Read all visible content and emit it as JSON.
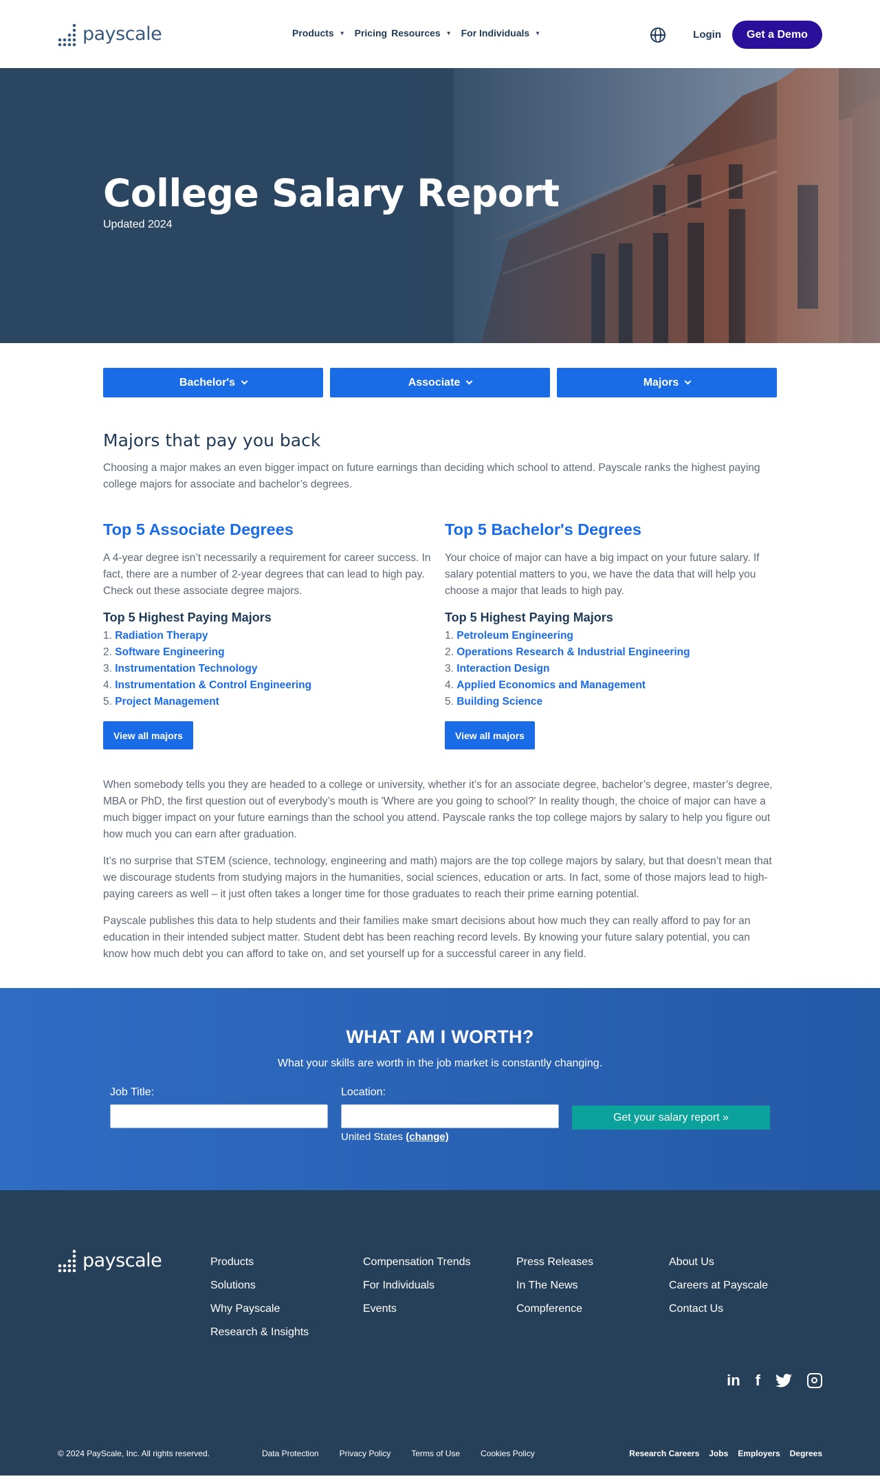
{
  "header": {
    "logo_text": "payscale",
    "nav": [
      "Products",
      "Pricing",
      "Resources",
      "For Individuals"
    ],
    "login": "Login",
    "demo": "Get a Demo"
  },
  "hero": {
    "title": "College Salary Report",
    "subtitle": "Updated 2024"
  },
  "degree_buttons": [
    "Bachelor's",
    "Associate",
    "Majors"
  ],
  "intro": {
    "title": "Majors that pay you back",
    "text": "Choosing a major makes an even bigger impact on future earnings than deciding which school to attend. Payscale ranks the highest paying college majors for associate and bachelor’s degrees."
  },
  "associate": {
    "title": "Top 5 Associate Degrees",
    "text": "A 4-year degree isn’t necessarily a requirement for career success. In fact, there are a number of 2-year degrees that can lead to high pay. Check out these associate degree majors.",
    "list_title": "Top 5 Highest Paying Majors",
    "majors": [
      "Radiation Therapy",
      "Software Engineering",
      "Instrumentation Technology",
      "Instrumentation & Control Engineering",
      "Project Management"
    ],
    "button": "View all majors"
  },
  "bachelor": {
    "title": "Top 5 Bachelor's Degrees",
    "text": "Your choice of major can have a big impact on your future salary. If salary potential matters to you, we have the data that will help you choose a major that leads to high pay.",
    "list_title": "Top 5 Highest Paying Majors",
    "majors": [
      "Petroleum Engineering",
      "Operations Research & Industrial Engineering",
      "Interaction Design",
      "Applied Economics and Management",
      "Building Science"
    ],
    "button": "View all majors"
  },
  "paragraphs": [
    "When somebody tells you they are headed to a college or university, whether it’s for an associate degree, bachelor’s degree, master’s degree, MBA or PhD, the first question out of everybody’s mouth is 'Where are you going to school?' In reality though, the choice of major can have a much bigger impact on your future earnings than the school you attend. Payscale ranks the top college majors by salary to help you figure out how much you can earn after graduation.",
    "It’s no surprise that STEM (science, technology, engineering and math) majors are the top college majors by salary, but that doesn’t mean that we discourage students from studying majors in the humanities, social sciences, education or arts. In fact, some of those majors lead to high-paying careers as well – it just often takes a longer time for those graduates to reach their prime earning potential.",
    "Payscale publishes this data to help students and their families make smart decisions about how much they can really afford to pay for an education in their intended subject matter. Student debt has been reaching record levels. By knowing your future salary potential, you can know how much debt you can afford to take on, and set yourself up for a successful career in any field."
  ],
  "worth": {
    "title": "WHAT AM I WORTH?",
    "subtitle": "What your skills are worth in the job market is constantly changing.",
    "job_label": "Job Title:",
    "job_value": "",
    "location_label": "Location:",
    "location_value": "",
    "button": "Get your salary report »",
    "country": "United States",
    "change": "(change)"
  },
  "footer": {
    "logo_text": "payscale",
    "col1": [
      "Products",
      "Solutions",
      "Why Payscale",
      "Research & Insights"
    ],
    "col2": [
      "Compensation Trends",
      "For Individuals",
      "Events"
    ],
    "col3": [
      "Press Releases",
      "In The News",
      "Compference"
    ],
    "col4": [
      "About Us",
      "Careers at Payscale",
      "Contact Us"
    ],
    "social": [
      "linkedin-icon",
      "facebook-icon",
      "twitter-icon",
      "instagram-icon"
    ],
    "copyright": "© 2024 PayScale, Inc. All rights reserved.",
    "legal": [
      "Data Protection",
      "Privacy Policy",
      "Terms of Use",
      "Cookies Policy"
    ],
    "right_links": [
      "Research Careers",
      "Jobs",
      "Employers",
      "Degrees"
    ]
  },
  "colors": {
    "brand_blue": "#1a6be6",
    "demo_purple": "#2a0f9a",
    "navy": "#27405a",
    "teal": "#0aa29a"
  }
}
